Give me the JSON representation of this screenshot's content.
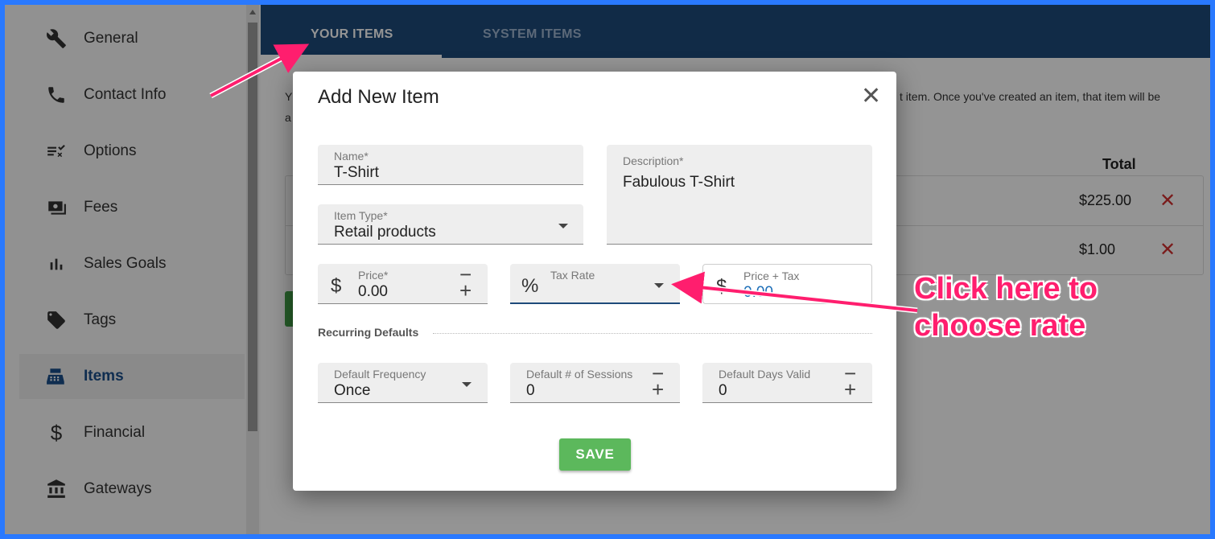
{
  "sidebar": {
    "items": [
      {
        "label": "General",
        "icon": "wrench-icon"
      },
      {
        "label": "Contact Info",
        "icon": "phone-icon"
      },
      {
        "label": "Options",
        "icon": "checklist-icon"
      },
      {
        "label": "Fees",
        "icon": "money-icon"
      },
      {
        "label": "Sales Goals",
        "icon": "bar-chart-icon"
      },
      {
        "label": "Tags",
        "icon": "tag-icon"
      },
      {
        "label": "Items",
        "icon": "cash-register-icon",
        "active": true
      },
      {
        "label": "Financial",
        "icon": "dollar-icon"
      },
      {
        "label": "Gateways",
        "icon": "bank-icon"
      }
    ]
  },
  "tabs": {
    "your_items": "YOUR ITEMS",
    "system_items": "SYSTEM ITEMS"
  },
  "background": {
    "text_left": "Y",
    "text_right": "t item. Once you've created an item, that item will be",
    "text_left2": "a",
    "total_header": "Total",
    "rows": [
      {
        "amount": "$225.00"
      },
      {
        "amount": "$1.00"
      }
    ]
  },
  "dialog": {
    "title": "Add New Item",
    "name": {
      "label": "Name*",
      "value": "T-Shirt"
    },
    "description": {
      "label": "Description*",
      "value": "Fabulous T-Shirt"
    },
    "item_type": {
      "label": "Item Type*",
      "value": "Retail products"
    },
    "price": {
      "label": "Price*",
      "prefix": "$",
      "value": "0.00"
    },
    "tax_rate": {
      "label": "Tax Rate",
      "prefix": "%",
      "value": ""
    },
    "price_tax": {
      "label": "Price + Tax",
      "prefix": "$",
      "value": "0.00"
    },
    "recurring_label": "Recurring Defaults",
    "frequency": {
      "label": "Default Frequency",
      "value": "Once"
    },
    "sessions": {
      "label": "Default # of Sessions",
      "value": "0"
    },
    "days_valid": {
      "label": "Default Days Valid",
      "value": "0"
    },
    "save_label": "SAVE"
  },
  "annotation": {
    "line1": "Click here to",
    "line2": "choose rate"
  },
  "colors": {
    "accent": "#1e4a7a",
    "save": "#5cb85c",
    "annotation": "#ff1e6e",
    "delete": "#d32f2f"
  }
}
